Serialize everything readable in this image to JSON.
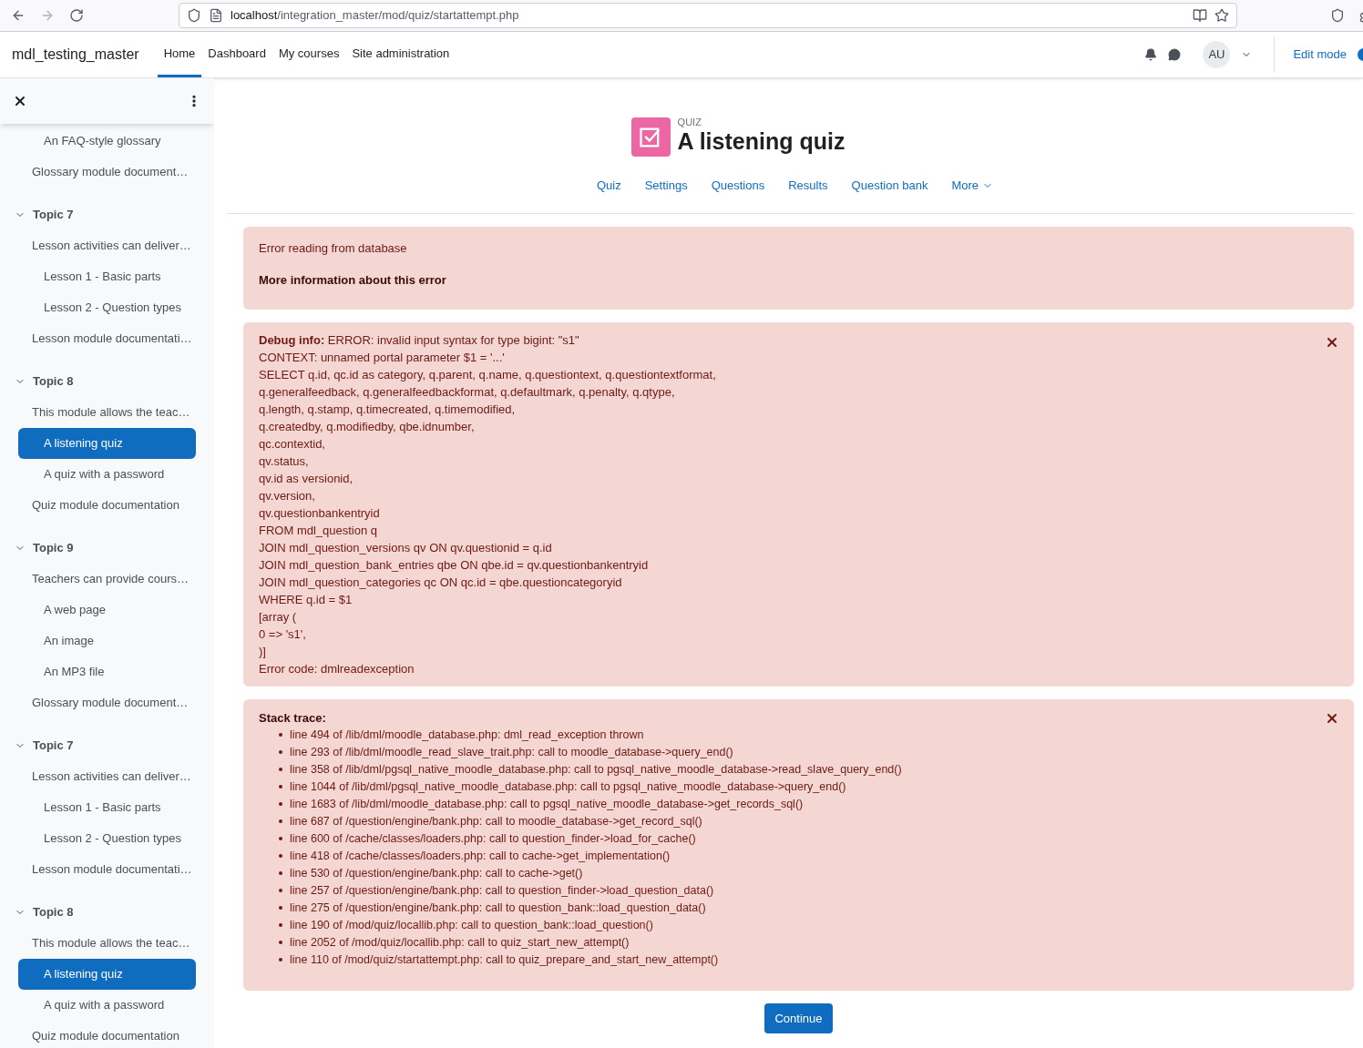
{
  "browser": {
    "url_host": "localhost",
    "url_path": "/integration_master/mod/quiz/startattempt.php"
  },
  "navbar": {
    "site_name": "mdl_testing_master",
    "links": [
      {
        "label": "Home",
        "selected": true
      },
      {
        "label": "Dashboard",
        "selected": false
      },
      {
        "label": "My courses",
        "selected": false
      },
      {
        "label": "Site administration",
        "selected": false
      }
    ],
    "avatar": "AU",
    "edit_mode": {
      "label": "Edit mode",
      "on": true
    }
  },
  "sidebar": {
    "groups": [
      {
        "items": [
          {
            "label": "An FAQ-style glossary",
            "kind": "activity",
            "selected": false
          },
          {
            "label": "Glossary module document…",
            "kind": "module",
            "selected": false
          }
        ]
      },
      {
        "topic": "Topic 7",
        "expanded": true,
        "items": [
          {
            "label": "Lesson activities can deliver…",
            "kind": "module",
            "selected": false
          },
          {
            "label": "Lesson 1 - Basic parts",
            "kind": "activity",
            "selected": false
          },
          {
            "label": "Lesson 2 - Question types",
            "kind": "activity",
            "selected": false
          },
          {
            "label": "Lesson module documentati…",
            "kind": "module",
            "selected": false
          }
        ]
      },
      {
        "topic": "Topic 8",
        "expanded": true,
        "items": [
          {
            "label": "This module allows the teac…",
            "kind": "module",
            "selected": false
          },
          {
            "label": "A listening quiz",
            "kind": "activity",
            "selected": true
          },
          {
            "label": "A quiz with a password",
            "kind": "activity",
            "selected": false
          },
          {
            "label": "Quiz module documentation",
            "kind": "module",
            "selected": false
          }
        ]
      },
      {
        "topic": "Topic 9",
        "expanded": true,
        "items": [
          {
            "label": "Teachers can provide cours…",
            "kind": "module",
            "selected": false
          },
          {
            "label": "A web page",
            "kind": "activity",
            "selected": false
          },
          {
            "label": "An image",
            "kind": "activity",
            "selected": false
          },
          {
            "label": "An MP3 file",
            "kind": "activity",
            "selected": false
          },
          {
            "label": "Glossary module document…",
            "kind": "module",
            "selected": false
          }
        ]
      },
      {
        "topic": "Topic 7",
        "expanded": true,
        "items": [
          {
            "label": "Lesson activities can deliver…",
            "kind": "module",
            "selected": false
          },
          {
            "label": "Lesson 1 - Basic parts",
            "kind": "activity",
            "selected": false
          },
          {
            "label": "Lesson 2 - Question types",
            "kind": "activity",
            "selected": false
          },
          {
            "label": "Lesson module documentati…",
            "kind": "module",
            "selected": false
          }
        ]
      },
      {
        "topic": "Topic 8",
        "expanded": true,
        "items": [
          {
            "label": "This module allows the teac…",
            "kind": "module",
            "selected": false
          },
          {
            "label": "A listening quiz",
            "kind": "activity",
            "selected": true
          },
          {
            "label": "A quiz with a password",
            "kind": "activity",
            "selected": false
          },
          {
            "label": "Quiz module documentation",
            "kind": "module",
            "selected": false
          }
        ]
      }
    ]
  },
  "header": {
    "kicker": "QUIZ",
    "title": "A listening quiz",
    "tabs": [
      {
        "label": "Quiz",
        "selected": false
      },
      {
        "label": "Settings",
        "selected": false
      },
      {
        "label": "Questions",
        "selected": false
      },
      {
        "label": "Results",
        "selected": false
      },
      {
        "label": "Question bank",
        "selected": false
      },
      {
        "label": "More",
        "selected": false
      }
    ]
  },
  "error": {
    "message": "Error reading from database",
    "more_info": "More information about this error"
  },
  "debug": {
    "lines": [
      "**Debug info:** ERROR: invalid input syntax for type bigint: \"s1\"",
      "CONTEXT: unnamed portal parameter $1 = '...'",
      "SELECT q.id, qc.id as category, q.parent, q.name, q.questiontext, q.questiontextformat,",
      "q.generalfeedback, q.generalfeedbackformat, q.defaultmark, q.penalty, q.qtype,",
      "q.length, q.stamp, q.timecreated, q.timemodified,",
      "q.createdby, q.modifiedby, qbe.idnumber,",
      "qc.contextid,",
      "qv.status,",
      "qv.id as versionid,",
      "qv.version,",
      "qv.questionbankentryid",
      "FROM mdl_question q",
      "JOIN mdl_question_versions qv ON qv.questionid = q.id",
      "JOIN mdl_question_bank_entries qbe ON qbe.id = qv.questionbankentryid",
      "JOIN mdl_question_categories qc ON qc.id = qbe.questioncategoryid",
      "WHERE q.id = $1",
      "[array (",
      "0 => 's1',",
      ")]",
      "Error code: dmlreadexception"
    ]
  },
  "stack": {
    "title": "Stack trace:",
    "lines": [
      "line 494 of /lib/dml/moodle_database.php: dml_read_exception thrown",
      "line 293 of /lib/dml/moodle_read_slave_trait.php: call to moodle_database->query_end()",
      "line 358 of /lib/dml/pgsql_native_moodle_database.php: call to pgsql_native_moodle_database->read_slave_query_end()",
      "line 1044 of /lib/dml/pgsql_native_moodle_database.php: call to pgsql_native_moodle_database->query_end()",
      "line 1683 of /lib/dml/moodle_database.php: call to pgsql_native_moodle_database->get_records_sql()",
      "line 687 of /question/engine/bank.php: call to moodle_database->get_record_sql()",
      "line 600 of /cache/classes/loaders.php: call to question_finder->load_for_cache()",
      "line 418 of /cache/classes/loaders.php: call to cache->get_implementation()",
      "line 530 of /question/engine/bank.php: call to cache->get()",
      "line 257 of /question/engine/bank.php: call to question_finder->load_question_data()",
      "line 275 of /question/engine/bank.php: call to question_bank::load_question_data()",
      "line 190 of /mod/quiz/locallib.php: call to question_bank::load_question()",
      "line 2052 of /mod/quiz/locallib.php: call to quiz_start_new_attempt()",
      "line 110 of /mod/quiz/startattempt.php: call to quiz_prepare_and_start_new_attempt()"
    ]
  },
  "continue_button": "Continue"
}
